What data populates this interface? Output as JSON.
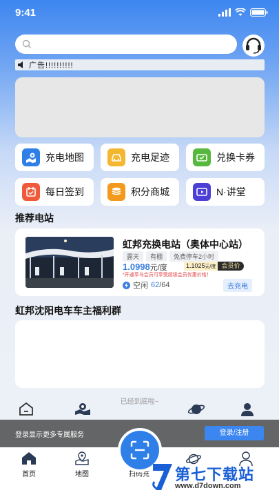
{
  "status_bar": {
    "time": "9:41"
  },
  "search": {
    "placeholder": ""
  },
  "notice": {
    "text": "广告!!!!!!!!!!"
  },
  "grid": [
    {
      "label": "充电地图",
      "icon": "map-pin-icon",
      "color": "#2f7fe9"
    },
    {
      "label": "充电足迹",
      "icon": "car-icon",
      "color": "#f4b731"
    },
    {
      "label": "兑换卡券",
      "icon": "ticket-icon",
      "color": "#56b83d"
    },
    {
      "label": "每日签到",
      "icon": "calendar-icon",
      "color": "#ef5a3a"
    },
    {
      "label": "积分商城",
      "icon": "coins-icon",
      "color": "#f39a1e"
    },
    {
      "label": "N·讲堂",
      "icon": "play-icon",
      "color": "#4b3fd6"
    }
  ],
  "recommended": {
    "title": "推荐电站",
    "station": {
      "name": "虹邦充换电站（奥体中心站）",
      "tags": [
        "露天",
        "有棚",
        "免费停车2小时"
      ],
      "price": "1.0998",
      "price_unit": "元/度",
      "member_price": "1.1025",
      "member_unit": "元/度",
      "member_badge": "会员价",
      "promo": "*开通享乌会员可享受超级会员优惠价格！",
      "idle_label": "空闲",
      "idle_available": "62",
      "idle_total": "/64",
      "go_button": "去充电"
    }
  },
  "group": {
    "title": "虹邦沈阳电车车主福利群"
  },
  "end_text": "已经到底啦~",
  "overlay": {
    "text": "登录显示更多专属服务",
    "login_button": "登录/注册"
  },
  "tabbar": [
    {
      "label": "首页",
      "icon": "home-icon"
    },
    {
      "label": "地图",
      "icon": "map-icon"
    },
    {
      "label": "扫码充",
      "icon": "scan-icon"
    },
    {
      "label": "",
      "icon": "planet-icon"
    },
    {
      "label": "",
      "icon": "user-icon"
    }
  ],
  "watermark": {
    "title": "第七下载站",
    "url": "www.d7down.com"
  },
  "colors": {
    "accent": "#2f7fe9",
    "price": "#3b7de0"
  }
}
